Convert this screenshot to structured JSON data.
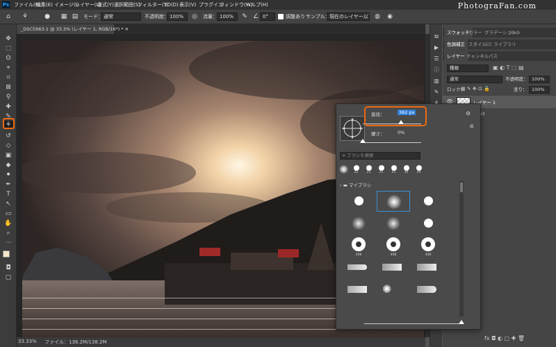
{
  "app": {
    "logo": "Ps",
    "watermark": "PhotograFan.com"
  },
  "menu": [
    "ファイル(F)",
    "編集(E)",
    "イメージ(I)",
    "レイヤー(L)",
    "書式(Y)",
    "選択範囲(S)",
    "フィルター(T)",
    "3D(D)",
    "表示(V)",
    "プラグイン",
    "ウィンドウ(W)",
    "ヘルプ(H)"
  ],
  "options": {
    "mode_label": "モード：",
    "mode_value": "通常",
    "opacity_label": "不透明度：",
    "opacity_value": "100%",
    "flow_label": "流量：",
    "flow_value": "100%",
    "angle_value": "0°",
    "aligned_label": "調整あり",
    "sample_label": "サンプル：",
    "sample_value": "現在のレイヤー以下"
  },
  "document": {
    "tab_title": "_DSC5963-1 @ 33.3% (レイヤー 1, RGB/16*) *",
    "zoom": "33.33%",
    "file_info": "ファイル：138.2M/138.2M"
  },
  "panels": {
    "top_tabs": [
      "スウォッチ",
      "カラー",
      "グラデーション",
      "Hub"
    ],
    "mid_tabs": [
      "色調補正",
      "スタイル",
      "CC ライブラリ"
    ],
    "layer_tabs": [
      "レイヤー",
      "チャンネル",
      "パス"
    ],
    "kind_label": "種類",
    "blend_mode": "通常",
    "opacity_label": "不透明度：",
    "opacity_value": "100%",
    "lock_label": "ロック：",
    "fill_label": "塗り：",
    "fill_value": "100%",
    "layers": [
      {
        "name": "レイヤー 1"
      },
      {
        "name": "5963"
      }
    ]
  },
  "brush_panel": {
    "size_label": "直径：",
    "size_value": "362 px",
    "size_fraction": 0.65,
    "hardness_label": "硬さ：",
    "hardness_value": "0%",
    "hardness_fraction": 0.0,
    "search_placeholder": "ブラシを検索",
    "presets": [
      "22",
      "21",
      "25",
      "25",
      "30",
      "20"
    ],
    "folder_name": "マイブラシ",
    "grid_numbers": [
      "408",
      "408",
      "408"
    ]
  },
  "colors": {
    "accent_orange": "#ee6a10",
    "selection_blue": "#3b8fd9",
    "highlight_text": "#2f7fd6"
  }
}
